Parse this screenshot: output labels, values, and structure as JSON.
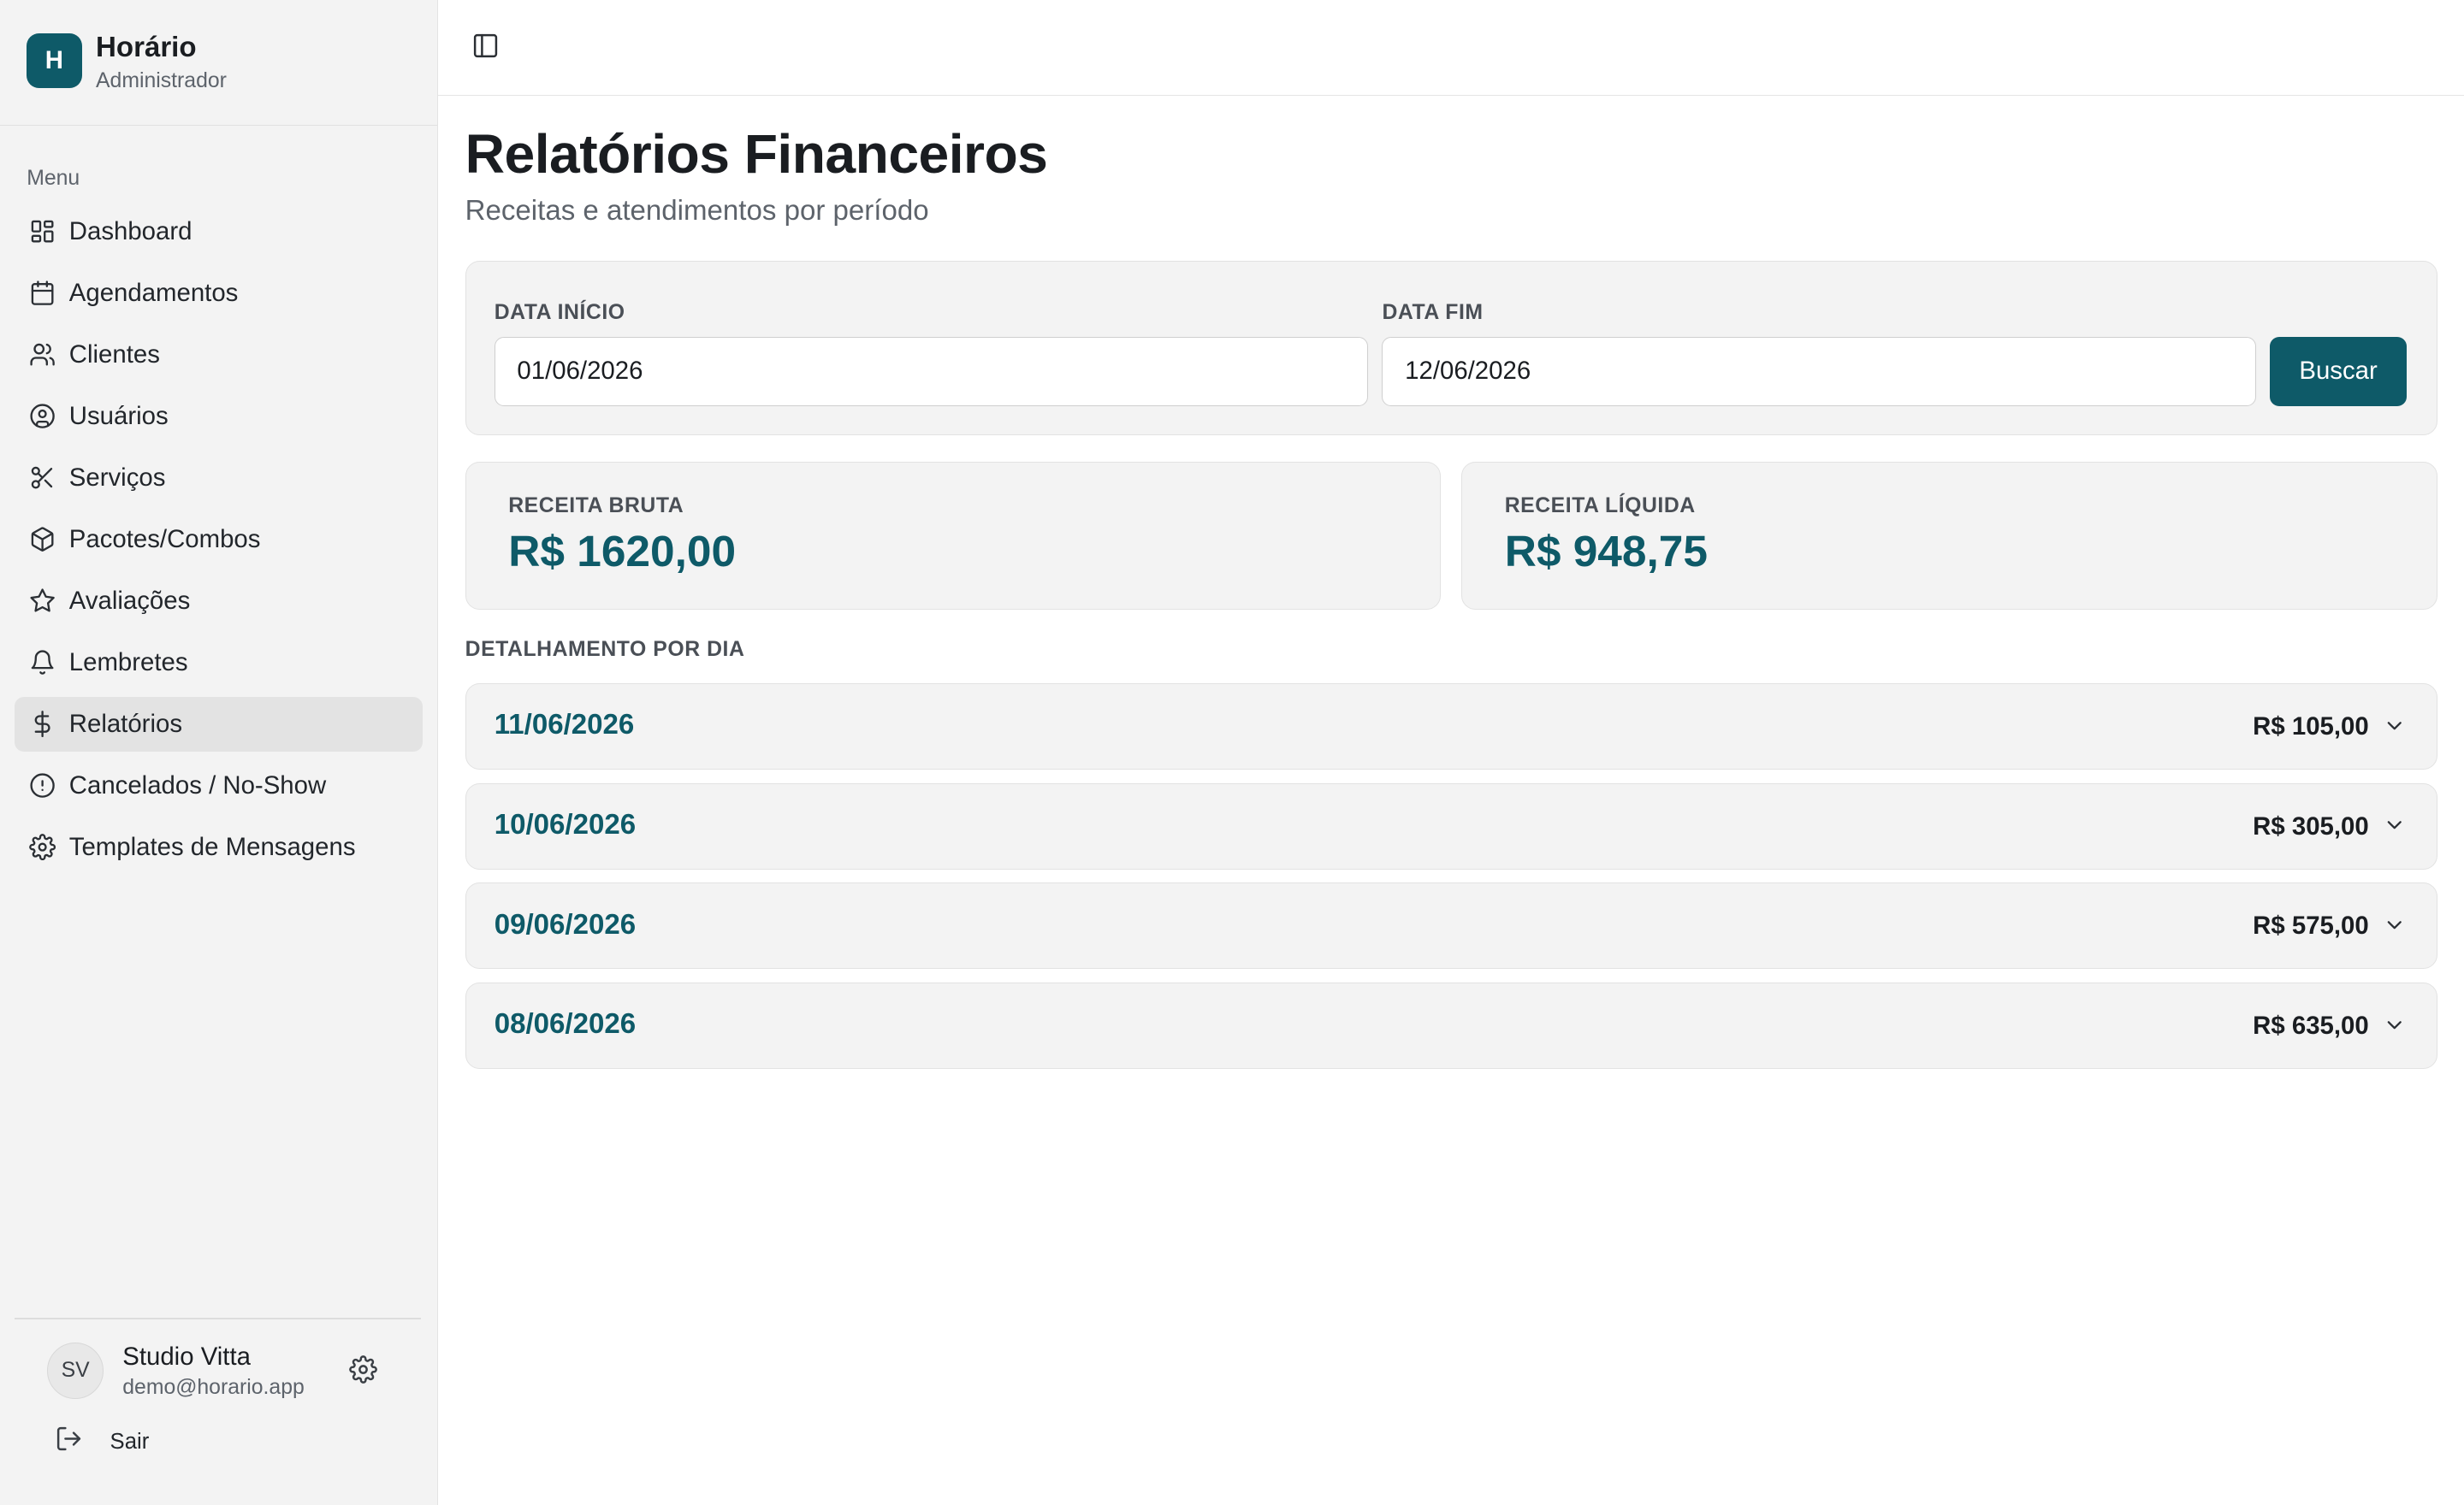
{
  "brand": {
    "logo_letter": "H",
    "name": "Horário",
    "role": "Administrador"
  },
  "sidebar": {
    "menu_caption": "Menu",
    "items": [
      {
        "label": "Dashboard",
        "icon": "dashboard-icon"
      },
      {
        "label": "Agendamentos",
        "icon": "calendar-icon"
      },
      {
        "label": "Clientes",
        "icon": "users-icon"
      },
      {
        "label": "Usuários",
        "icon": "user-circle-icon"
      },
      {
        "label": "Serviços",
        "icon": "scissors-icon"
      },
      {
        "label": "Pacotes/Combos",
        "icon": "package-icon"
      },
      {
        "label": "Avaliações",
        "icon": "star-icon"
      },
      {
        "label": "Lembretes",
        "icon": "bell-icon"
      },
      {
        "label": "Relatórios",
        "icon": "dollar-icon",
        "active": true
      },
      {
        "label": "Cancelados / No-Show",
        "icon": "alert-circle-icon"
      },
      {
        "label": "Templates de Mensagens",
        "icon": "gear-icon"
      }
    ]
  },
  "user": {
    "initials": "SV",
    "name": "Studio Vitta",
    "email": "demo@horario.app",
    "logout_label": "Sair"
  },
  "page": {
    "title": "Relatórios Financeiros",
    "subtitle": "Receitas e atendimentos por período"
  },
  "filters": {
    "start_label": "DATA INÍCIO",
    "start_value": "01/06/2026",
    "end_label": "DATA FIM",
    "end_value": "12/06/2026",
    "search_label": "Buscar"
  },
  "stats": {
    "gross_label": "RECEITA BRUTA",
    "gross_value": "R$ 1620,00",
    "net_label": "RECEITA LÍQUIDA",
    "net_value": "R$ 948,75"
  },
  "breakdown": {
    "caption": "DETALHAMENTO POR DIA",
    "days": [
      {
        "date": "11/06/2026",
        "amount": "R$ 105,00"
      },
      {
        "date": "10/06/2026",
        "amount": "R$ 305,00"
      },
      {
        "date": "09/06/2026",
        "amount": "R$ 575,00"
      },
      {
        "date": "08/06/2026",
        "amount": "R$ 635,00"
      }
    ]
  },
  "colors": {
    "accent": "#0e5a68",
    "sidebar_bg": "#f3f3f3",
    "card_bg": "#f3f3f3"
  }
}
